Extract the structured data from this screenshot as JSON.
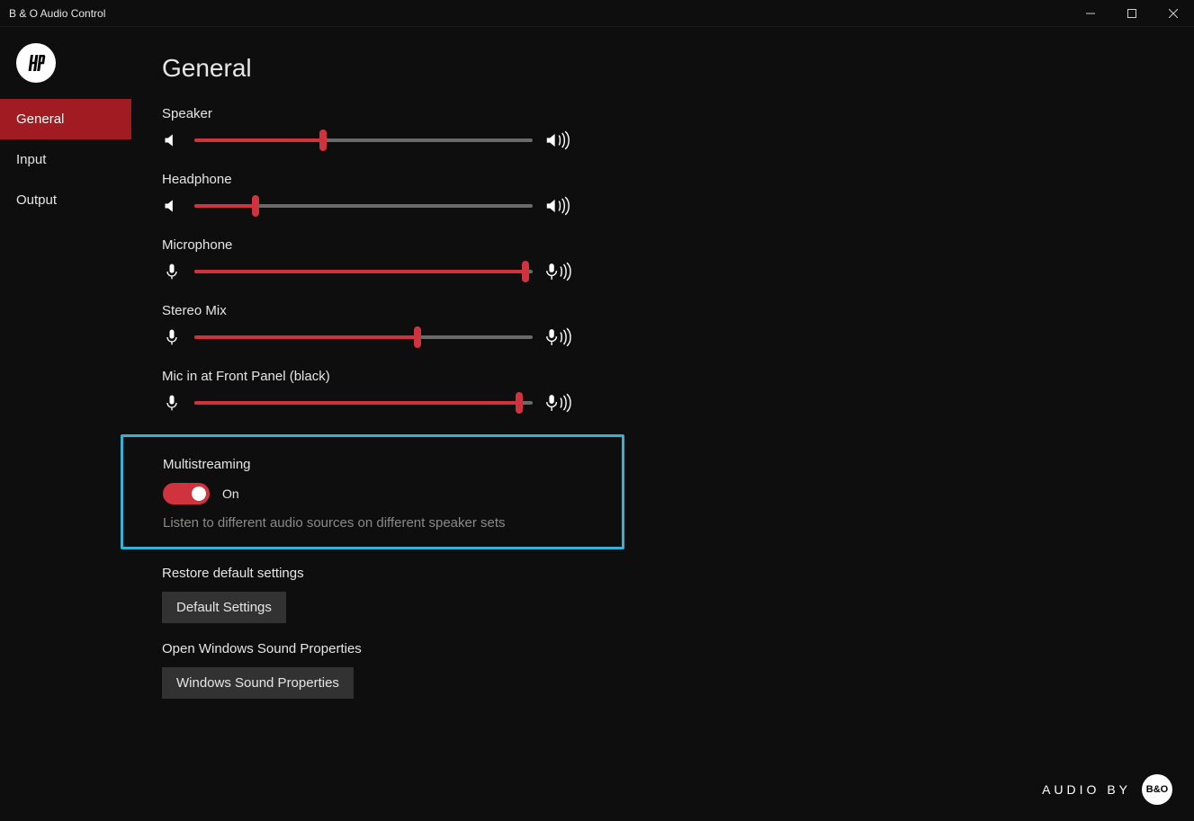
{
  "window": {
    "title": "B & O Audio Control"
  },
  "sidebar": {
    "items": [
      {
        "label": "General",
        "active": true
      },
      {
        "label": "Input",
        "active": false
      },
      {
        "label": "Output",
        "active": false
      }
    ]
  },
  "page": {
    "title": "General"
  },
  "sliders": [
    {
      "label": "Speaker",
      "value": 38,
      "iconLeft": "speaker",
      "iconRight": "speaker-waves"
    },
    {
      "label": "Headphone",
      "value": 18,
      "iconLeft": "speaker",
      "iconRight": "speaker-waves"
    },
    {
      "label": "Microphone",
      "value": 98,
      "iconLeft": "mic",
      "iconRight": "mic-waves"
    },
    {
      "label": "Stereo Mix",
      "value": 66,
      "iconLeft": "mic",
      "iconRight": "mic-waves"
    },
    {
      "label": "Mic in at Front Panel (black)",
      "value": 96,
      "iconLeft": "mic",
      "iconRight": "mic-waves"
    }
  ],
  "multistreaming": {
    "title": "Multistreaming",
    "state": "On",
    "on": true,
    "description": "Listen to different audio sources on different speaker sets"
  },
  "restore": {
    "title": "Restore default settings",
    "button": "Default Settings"
  },
  "soundProps": {
    "title": "Open Windows Sound Properties",
    "button": "Windows Sound Properties"
  },
  "footer": {
    "text": "AUDIO BY",
    "badge": "B&O"
  }
}
